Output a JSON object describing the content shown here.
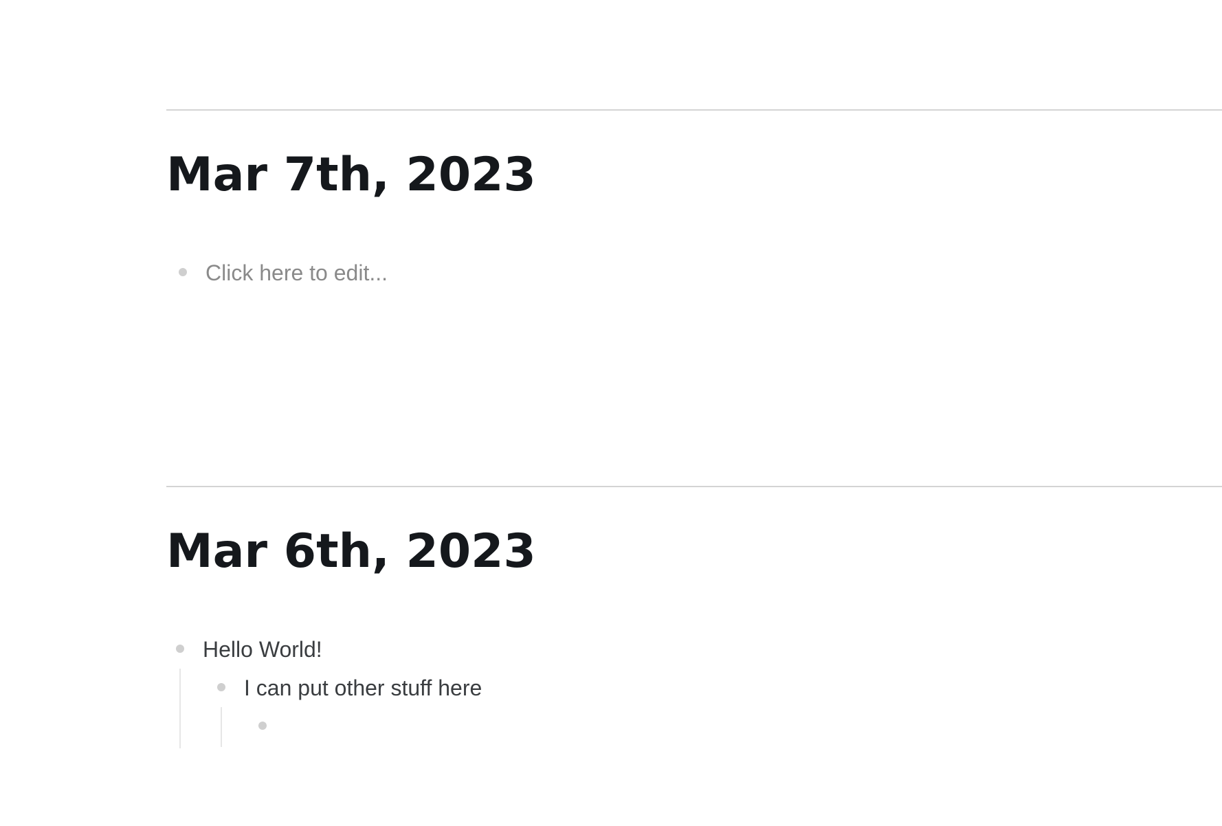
{
  "journal": {
    "days": [
      {
        "title": "Mar 7th, 2023",
        "blocks": [
          {
            "text": "Click here to edit...",
            "placeholder": true
          }
        ]
      },
      {
        "title": "Mar 6th, 2023",
        "blocks": [
          {
            "text": "Hello World!"
          },
          {
            "text": "I can put other stuff here"
          },
          {
            "text": ""
          }
        ]
      }
    ]
  },
  "colors": {
    "heading": "#15181c",
    "body_text": "#3a3d40",
    "placeholder_text": "#8a8a8a",
    "bullet": "#cfcfcf",
    "divider": "#d4d4d4",
    "thread_line": "#e6e6e6",
    "background": "#ffffff"
  }
}
